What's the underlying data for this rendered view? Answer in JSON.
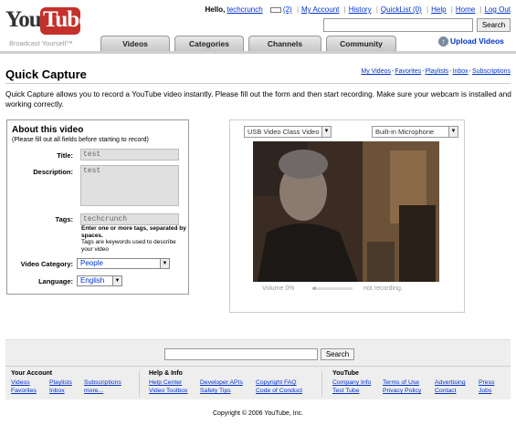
{
  "header": {
    "logo_you": "You",
    "logo_tube": "Tube",
    "slogan": "Broadcast Yourself™",
    "greeting": "Hello,",
    "username": "techcrunch",
    "inbox_count": "(2)",
    "links": [
      "My Account",
      "History",
      "QuickList (0)",
      "Help",
      "Home",
      "Log Out"
    ],
    "search_button": "Search",
    "tabs": [
      "Videos",
      "Categories",
      "Channels",
      "Community"
    ],
    "upload": "Upload Videos"
  },
  "page": {
    "title": "Quick Capture",
    "sublinks": [
      "My Videos",
      "Favorites",
      "Playlists",
      "Inbox",
      "Subscriptions"
    ],
    "intro": "Quick Capture allows you to record a YouTube video instantly. Please fill out the form and then start recording. Make sure your webcam is installed and working correctly."
  },
  "about": {
    "heading": "About this video",
    "note": "(Please fill out all fields before starting to record)",
    "title_label": "Title:",
    "title_value": "test",
    "description_label": "Description:",
    "description_value": "test",
    "tags_label": "Tags:",
    "tags_value": "techcrunch",
    "tags_help_bold": "Enter one or more tags, separated by spaces.",
    "tags_help": "Tags are keywords used to describe your video",
    "category_label": "Video Category:",
    "category_value": "People",
    "language_label": "Language:",
    "language_value": "English"
  },
  "capture": {
    "camera": "USB Video Class Video",
    "microphone": "Built-in Microphone",
    "volume": "Volume 0%",
    "status": "not recording."
  },
  "footer": {
    "search_button": "Search",
    "col1_head": "Your Account",
    "col1_links": [
      "Videos",
      "Playlists",
      "Subscriptions",
      "Favorites",
      "Inbox",
      "more..."
    ],
    "col2_head": "Help & Info",
    "col2_links": [
      "Help Center",
      "Developer APIs",
      "Copyright FAQ",
      "Video Toolbox",
      "Safety Tips",
      "Code of Conduct"
    ],
    "col3_head": "YouTube",
    "col3_links": [
      "Company Info",
      "Terms of Use",
      "Advertising",
      "Press",
      "Test Tube",
      "Privacy Policy",
      "Contact",
      "Jobs"
    ],
    "copyright": "Copyright © 2006 YouTube, Inc."
  },
  "colors": {
    "link": "#0033cc",
    "logo_red": "#c4302b"
  }
}
